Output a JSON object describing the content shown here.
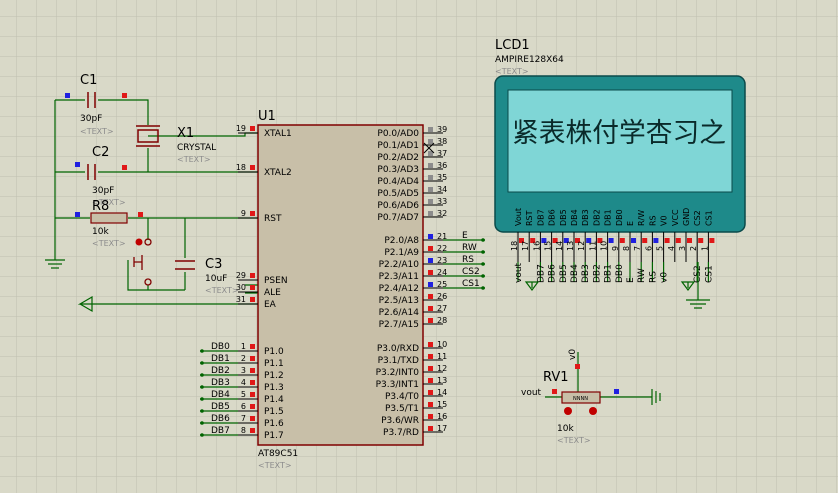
{
  "components": {
    "c1": {
      "ref": "C1",
      "value": "30pF",
      "text": "<TEXT>"
    },
    "c2": {
      "ref": "C2",
      "value": "30pF",
      "text": "<TEXT>"
    },
    "c3": {
      "ref": "C3",
      "value": "10uF",
      "text": "<TEXT>"
    },
    "x1": {
      "ref": "X1",
      "value": "CRYSTAL",
      "text": "<TEXT>"
    },
    "r8": {
      "ref": "R8",
      "value": "10k",
      "text": "<TEXT>"
    },
    "u1": {
      "ref": "U1",
      "part": "AT89C51",
      "text": "<TEXT>"
    },
    "lcd1": {
      "ref": "LCD1",
      "part": "AMPIRE128X64",
      "text": "<TEXT>",
      "screen_text": "紧表株付学杏习之"
    },
    "rv1": {
      "ref": "RV1",
      "value": "10k",
      "text": "<TEXT>",
      "body_label": "NNNN"
    }
  },
  "u1_left_pins": [
    {
      "num": "19",
      "name": "XTAL1"
    },
    {
      "num": "18",
      "name": "XTAL2"
    },
    {
      "num": "9",
      "name": "RST"
    },
    {
      "num": "29",
      "name": "PSEN"
    },
    {
      "num": "30",
      "name": "ALE"
    },
    {
      "num": "31",
      "name": "EA"
    },
    {
      "num": "1",
      "name": "P1.0"
    },
    {
      "num": "2",
      "name": "P1.1"
    },
    {
      "num": "3",
      "name": "P1.2"
    },
    {
      "num": "4",
      "name": "P1.3"
    },
    {
      "num": "5",
      "name": "P1.4"
    },
    {
      "num": "6",
      "name": "P1.5"
    },
    {
      "num": "7",
      "name": "P1.6"
    },
    {
      "num": "8",
      "name": "P1.7"
    }
  ],
  "u1_right_pins": [
    {
      "num": "39",
      "name": "P0.0/AD0"
    },
    {
      "num": "38",
      "name": "P0.1/AD1"
    },
    {
      "num": "37",
      "name": "P0.2/AD2"
    },
    {
      "num": "36",
      "name": "P0.3/AD3"
    },
    {
      "num": "35",
      "name": "P0.4/AD4"
    },
    {
      "num": "34",
      "name": "P0.5/AD5"
    },
    {
      "num": "33",
      "name": "P0.6/AD6"
    },
    {
      "num": "32",
      "name": "P0.7/AD7"
    },
    {
      "num": "21",
      "name": "P2.0/A8"
    },
    {
      "num": "22",
      "name": "P2.1/A9"
    },
    {
      "num": "23",
      "name": "P2.2/A10"
    },
    {
      "num": "24",
      "name": "P2.3/A11"
    },
    {
      "num": "25",
      "name": "P2.4/A12"
    },
    {
      "num": "26",
      "name": "P2.5/A13"
    },
    {
      "num": "27",
      "name": "P2.6/A14"
    },
    {
      "num": "28",
      "name": "P2.7/A15"
    },
    {
      "num": "10",
      "name": "P3.0/RXD"
    },
    {
      "num": "11",
      "name": "P3.1/TXD"
    },
    {
      "num": "12",
      "name": "P3.2/INT0"
    },
    {
      "num": "13",
      "name": "P3.3/INT1"
    },
    {
      "num": "14",
      "name": "P3.4/T0"
    },
    {
      "num": "15",
      "name": "P3.5/T1"
    },
    {
      "num": "16",
      "name": "P3.6/WR"
    },
    {
      "num": "17",
      "name": "P3.7/RD"
    }
  ],
  "p2_net_labels": [
    "E",
    "RW",
    "RS",
    "CS2",
    "CS1"
  ],
  "db_labels": [
    "DB0",
    "DB1",
    "DB2",
    "DB3",
    "DB4",
    "DB5",
    "DB6",
    "DB7"
  ],
  "lcd_pins": [
    {
      "num": "18",
      "name": "Vout",
      "net": "vout"
    },
    {
      "num": "17",
      "name": "RST",
      "net": ""
    },
    {
      "num": "16",
      "name": "DB7",
      "net": "DB7"
    },
    {
      "num": "15",
      "name": "DB6",
      "net": "DB6"
    },
    {
      "num": "14",
      "name": "DB5",
      "net": "DB5"
    },
    {
      "num": "13",
      "name": "DB4",
      "net": "DB4"
    },
    {
      "num": "12",
      "name": "DB3",
      "net": "DB3"
    },
    {
      "num": "11",
      "name": "DB2",
      "net": "DB2"
    },
    {
      "num": "10",
      "name": "DB1",
      "net": "DB1"
    },
    {
      "num": "9",
      "name": "DB0",
      "net": "DB0"
    },
    {
      "num": "8",
      "name": "E",
      "net": "E"
    },
    {
      "num": "7",
      "name": "R/W",
      "net": "RW"
    },
    {
      "num": "6",
      "name": "RS",
      "net": "RS"
    },
    {
      "num": "5",
      "name": "V0",
      "net": "v0"
    },
    {
      "num": "4",
      "name": "VCC",
      "net": ""
    },
    {
      "num": "3",
      "name": "GND",
      "net": ""
    },
    {
      "num": "2",
      "name": "CS2",
      "net": "CS2"
    },
    {
      "num": "1",
      "name": "CS1",
      "net": "CS1"
    }
  ],
  "rv1_nets": {
    "v0": "v0",
    "vout": "vout"
  },
  "colors": {
    "background": "#d9d9c8",
    "grid": "#bfbfb0",
    "wire": "#006400",
    "component_outline": "#800000",
    "chip_fill": "#c8bfa8",
    "lcd_body": "#1e8a8a",
    "lcd_screen": "#7fd6d6",
    "pin_red": "#e01818",
    "pin_blue": "#2020e0",
    "pin_grey": "#8c8c8c"
  }
}
